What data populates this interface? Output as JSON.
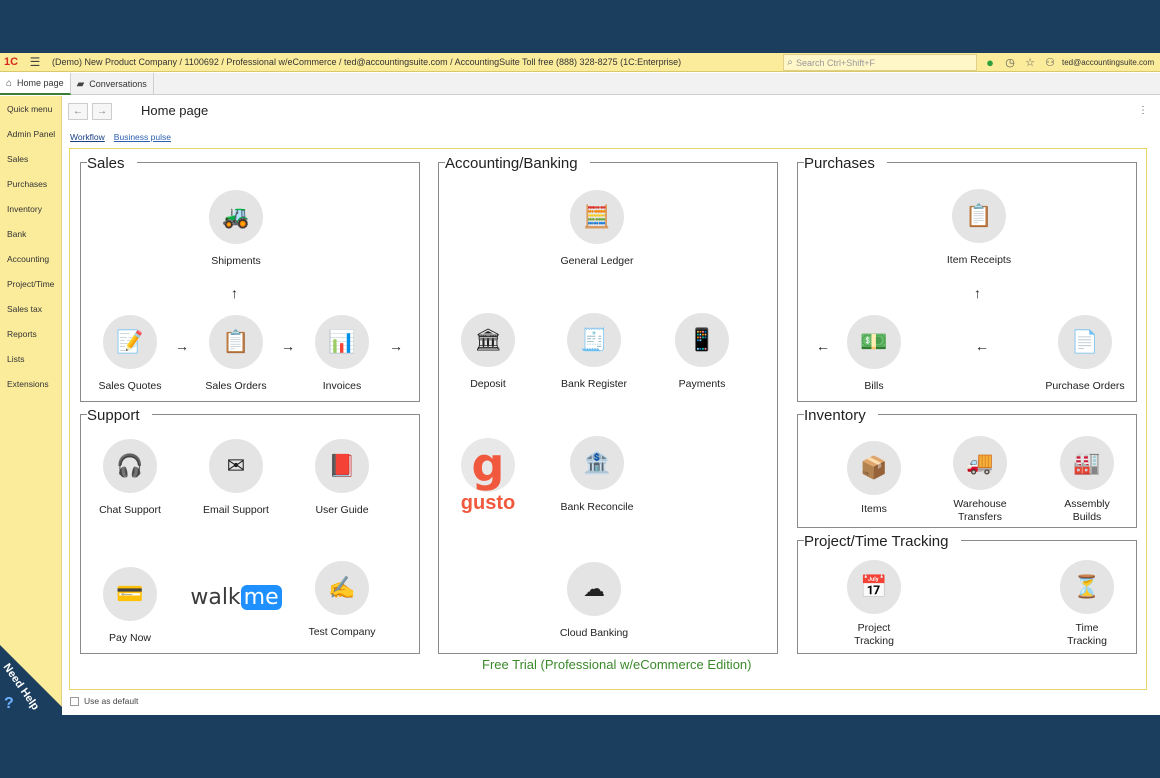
{
  "topbar": {
    "logo": "1C",
    "title": "(Demo) New Product Company / 1100692 / Professional w/eCommerce / ted@accountingsuite.com / AccountingSuite Toll free (888) 328-8275  (1C:Enterprise)",
    "search_placeholder": "Search Ctrl+Shift+F",
    "user": "ted@accountingsuite.com"
  },
  "tabs": [
    {
      "label": "Home page",
      "icon": "home-icon"
    },
    {
      "label": "Conversations",
      "icon": "chat-icon"
    }
  ],
  "sidebar": {
    "items": [
      "Quick menu",
      "Admin Panel",
      "Sales",
      "Purchases",
      "Inventory",
      "Bank",
      "Accounting",
      "Project/Time",
      "Sales tax",
      "Reports",
      "Lists",
      "Extensions"
    ],
    "need_help": "Need Help",
    "need_help_icon": "?"
  },
  "header": {
    "back": "←",
    "forward": "→",
    "title": "Home page",
    "more": "⋮"
  },
  "subnav": {
    "workflow": "Workflow",
    "business_pulse": "Business pulse"
  },
  "panels": {
    "sales": {
      "title": "Sales",
      "shipments": "Shipments",
      "sales_quotes": "Sales Quotes",
      "sales_orders": "Sales Orders",
      "invoices": "Invoices"
    },
    "support": {
      "title": "Support",
      "chat": "Chat Support",
      "email": "Email Support",
      "guide": "User Guide",
      "pay": "Pay Now",
      "walkme_logo": "walk",
      "walkme_me": "me",
      "test": "Test Company"
    },
    "accounting": {
      "title": "Accounting/Banking",
      "general_ledger": "General Ledger",
      "deposit": "Deposit",
      "bank_register": "Bank Register",
      "payments": "Payments",
      "gusto_g": "g",
      "gusto_word": "gusto",
      "bank_reconcile": "Bank Reconcile",
      "cloud_banking": "Cloud Banking"
    },
    "purchases": {
      "title": "Purchases",
      "item_receipts": "Item Receipts",
      "bills": "Bills",
      "purchase_orders": "Purchase Orders"
    },
    "inventory": {
      "title": "Inventory",
      "items": "Items",
      "warehouse": "Warehouse Transfers",
      "assembly": "Assembly Builds"
    },
    "project": {
      "title": "Project/Time Tracking",
      "project_tracking": "Project Tracking",
      "time_tracking": "Time Tracking"
    }
  },
  "arrows": {
    "right": "→",
    "left": "←",
    "up": "↑"
  },
  "free_trial": "Free Trial (Professional w/eCommerce Edition)",
  "use_as_default": "Use as default"
}
